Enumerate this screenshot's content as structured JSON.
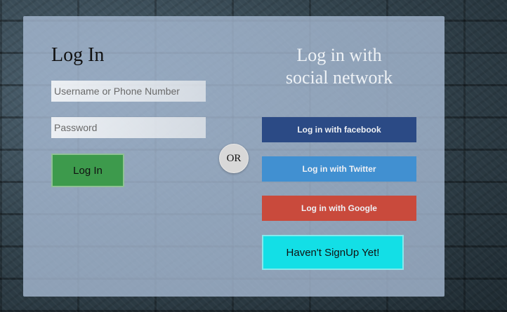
{
  "login": {
    "title": "Log In",
    "username_placeholder": "Username or Phone Number",
    "password_placeholder": "Password",
    "submit_label": "Log In"
  },
  "divider": {
    "label": "OR"
  },
  "social": {
    "title_line1": "Log in with",
    "title_line2": "social network",
    "facebook_label": "Log in with facebook",
    "twitter_label": "Log in with Twitter",
    "google_label": "Log in with Google",
    "signup_label": "Haven't SignUp Yet!"
  },
  "colors": {
    "login_button": "#3d9a4c",
    "facebook": "#2b4a85",
    "twitter": "#4190d1",
    "google": "#c94a3c",
    "signup": "#13dfe6"
  }
}
